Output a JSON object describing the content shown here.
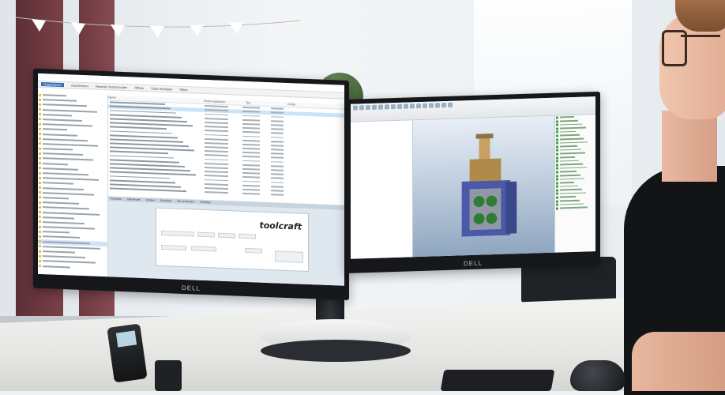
{
  "scene": {
    "description_tags": [
      "office",
      "dual-monitor",
      "cad-workstation",
      "person"
    ]
  },
  "left_monitor": {
    "brand": "DELL",
    "explorer": {
      "ribbon_tabs": [
        "Organisieren",
        "Auschecken",
        "Neueste Version laden",
        "Öffnen",
        "Datei anzeigen",
        "Teilen"
      ],
      "columns": [
        "Name",
        "Änderungsdatum",
        "Typ",
        "Größe"
      ],
      "toolcraft_logo": "toolcraft",
      "tabs": [
        "Vorschau",
        "Datenkarte",
        "Version",
        "Stückliste",
        "Wo verwendet",
        "Verweise"
      ]
    }
  },
  "right_monitor": {
    "brand": "DELL"
  }
}
